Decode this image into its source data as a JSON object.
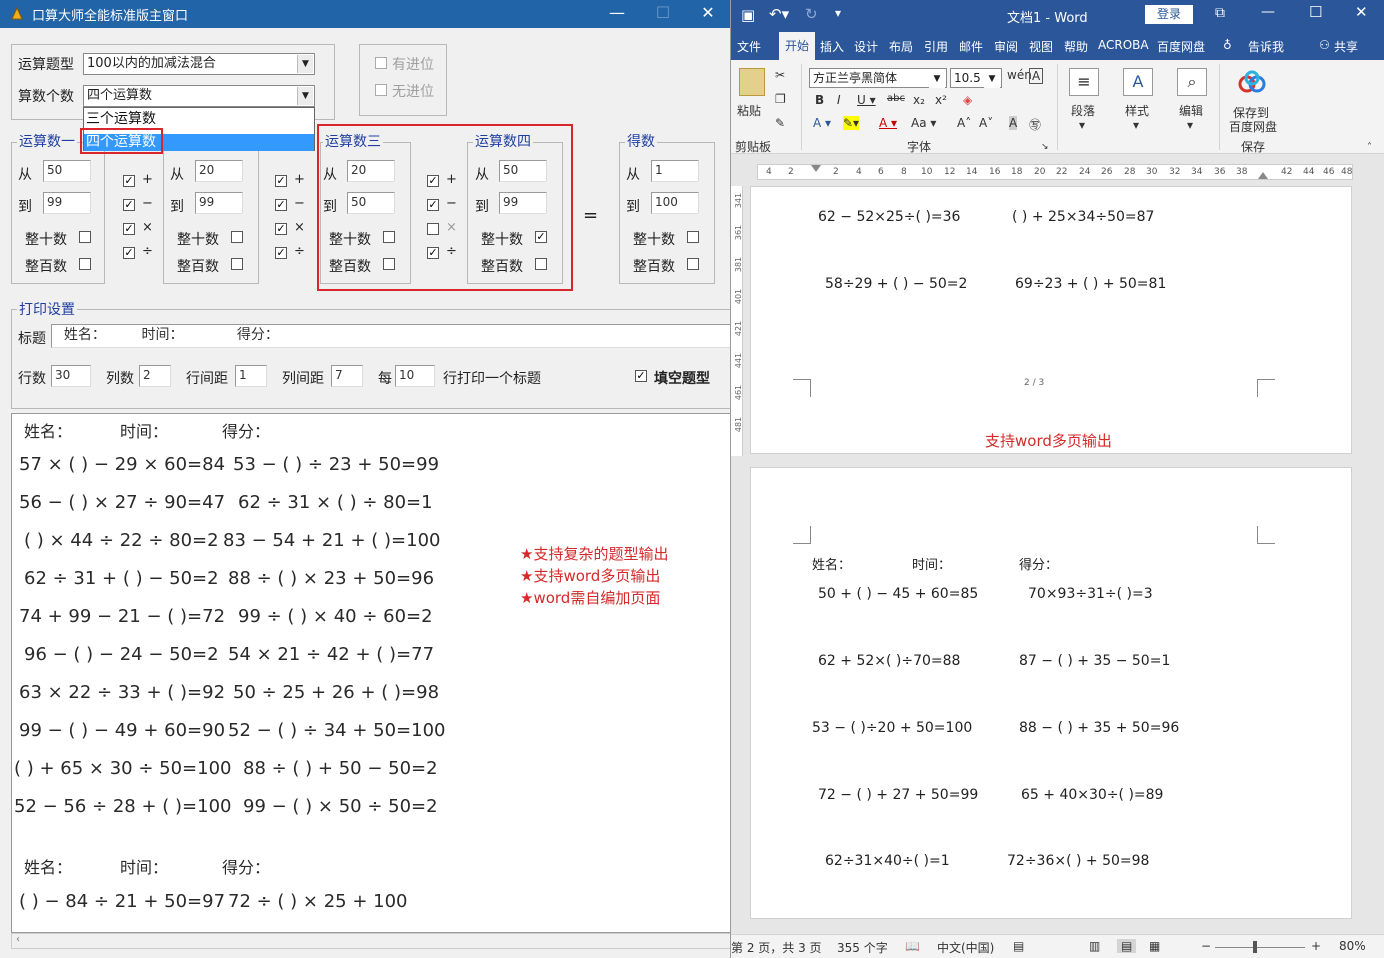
{
  "left_window": {
    "title": "口算大师全能标准版主窗口",
    "topic_label": "运算题型",
    "topic_value": "100以内的加减法混合",
    "count_label": "算数个数",
    "count_value": "四个运算数",
    "dropdown_option_1": "三个运算数",
    "dropdown_option_2": "四个运算数",
    "carry_yes": "有进位",
    "carry_no": "无进位",
    "group1_title": "运算数一",
    "group3_title": "运算数三",
    "group4_title": "运算数四",
    "result_title": "得数",
    "from_label": "从",
    "to_label": "到",
    "whole_ten": "整十数",
    "whole_hundred": "整百数",
    "g1_from": "50",
    "g1_to": "99",
    "g2_from": "20",
    "g2_to": "99",
    "g3_from": "20",
    "g3_to": "50",
    "g4_from": "50",
    "g4_to": "99",
    "res_from": "1",
    "res_to": "100",
    "op_plus": "+",
    "op_minus": "−",
    "op_times": "×",
    "op_div": "÷",
    "equals": "=",
    "check": "✓",
    "print_title": "打印设置",
    "header_label": "标题",
    "header_value": "  姓名：        时间：            得分：",
    "rows_label": "行数",
    "rows_value": "30",
    "cols_label": "列数",
    "cols_value": "2",
    "rowgap_label": "行间距",
    "rowgap_value": "1",
    "colgap_label": "列间距",
    "colgap_value": "7",
    "every_label": "每",
    "every_value": "10",
    "every_suffix": "行打印一个标题",
    "fill_blank": "填空题型",
    "out_header": {
      "name": "姓名：",
      "time": "时间：",
      "score": "得分："
    },
    "lines": [
      [
        "57 × (     ) − 29 × 60=84",
        "53 − (     ) ÷ 23 + 50=99"
      ],
      [
        "56 − (     ) × 27 ÷ 90=47",
        "62 ÷ 31 × (     ) ÷ 80=1"
      ],
      [
        "(     ) × 44 ÷ 22 ÷ 80=2",
        "83 − 54 + 21 + (     )=100"
      ],
      [
        "62 ÷ 31 + (     ) − 50=2",
        "88 ÷ (     ) × 23 + 50=96"
      ],
      [
        "74 + 99 − 21 − (     )=72",
        "99 ÷ (     ) × 40 ÷ 60=2"
      ],
      [
        "96 − (     ) − 24 − 50=2",
        "54 × 21 ÷ 42 + (     )=77"
      ],
      [
        "63 × 22 ÷ 33 + (     )=92",
        "50 ÷ 25 + 26 + (     )=98"
      ],
      [
        "99 − (     ) − 49 + 60=90",
        "52 − (     ) ÷ 34 + 50=100"
      ],
      [
        "(     ) + 65 × 30 ÷ 50=100",
        "88 ÷ (     ) + 50 − 50=2"
      ],
      [
        "52 − 56 ÷ 28 + (     )=100",
        "99 − (     ) × 50 ÷ 50=2"
      ]
    ],
    "last_line": [
      "(     ) − 84 ÷ 21 + 50=97",
      "72 ÷ (     ) × 25 + 100"
    ],
    "features": [
      "★支持复杂的题型输出",
      "★支持word多页输出",
      "★word需自编加页面"
    ]
  },
  "word": {
    "title": "文档1  -  Word",
    "login": "登录",
    "tabs": [
      "文件",
      "开始",
      "插入",
      "设计",
      "布局",
      "引用",
      "邮件",
      "审阅",
      "视图",
      "帮助",
      "ACROBA",
      "百度网盘"
    ],
    "tell_me": "告诉我",
    "share": "共享",
    "font_name": "方正兰亭黑简体",
    "font_size": "10.5",
    "paste": "粘贴",
    "clipboard": "剪贴板",
    "font_group": "字体",
    "paragraph": "段落",
    "styles": "样式",
    "editing": "编辑",
    "save_baidu_1": "保存到",
    "save_baidu_2": "百度网盘",
    "save": "保存",
    "ruler_nums": [
      "4",
      "2",
      "",
      "2",
      "4",
      "6",
      "8",
      "10",
      "12",
      "14",
      "16",
      "18",
      "20",
      "22",
      "24",
      "26",
      "28",
      "30",
      "32",
      "34",
      "36",
      "38",
      "",
      "42",
      "44",
      "46",
      "48"
    ],
    "vruler_nums": [
      "341",
      "361",
      "381",
      "401",
      "421",
      "441",
      "461",
      "481"
    ],
    "page1_lines": [
      [
        "62 − 52×25÷(        )=36",
        "(        ) + 25×34÷50=87"
      ],
      [
        "58÷29 + (        ) − 50=2",
        "69÷23 + (        ) + 50=81"
      ]
    ],
    "page_num": "2 / 3",
    "multipage_note": "支持word多页输出",
    "page2_header": {
      "name": "姓名：",
      "time": "时间：",
      "score": "得分："
    },
    "page2_lines": [
      [
        "50 + (        ) − 45 + 60=85",
        "70×93÷31÷(        )=3"
      ],
      [
        "62 + 52×(        )÷70=88",
        "87 − (        ) + 35 − 50=1"
      ],
      [
        "53 − (        )÷20 + 50=100",
        "88 − (        ) + 35 + 50=96"
      ],
      [
        "72 − (        ) + 27 + 50=99",
        "65 + 40×30÷(        )=89"
      ],
      [
        "62÷31×40÷(        )=1",
        "72÷36×(        ) + 50=98"
      ]
    ],
    "status_page": "第 2 页，共 3 页",
    "status_words": "355 个字",
    "status_lang": "中文(中国)",
    "zoom": "80%"
  }
}
